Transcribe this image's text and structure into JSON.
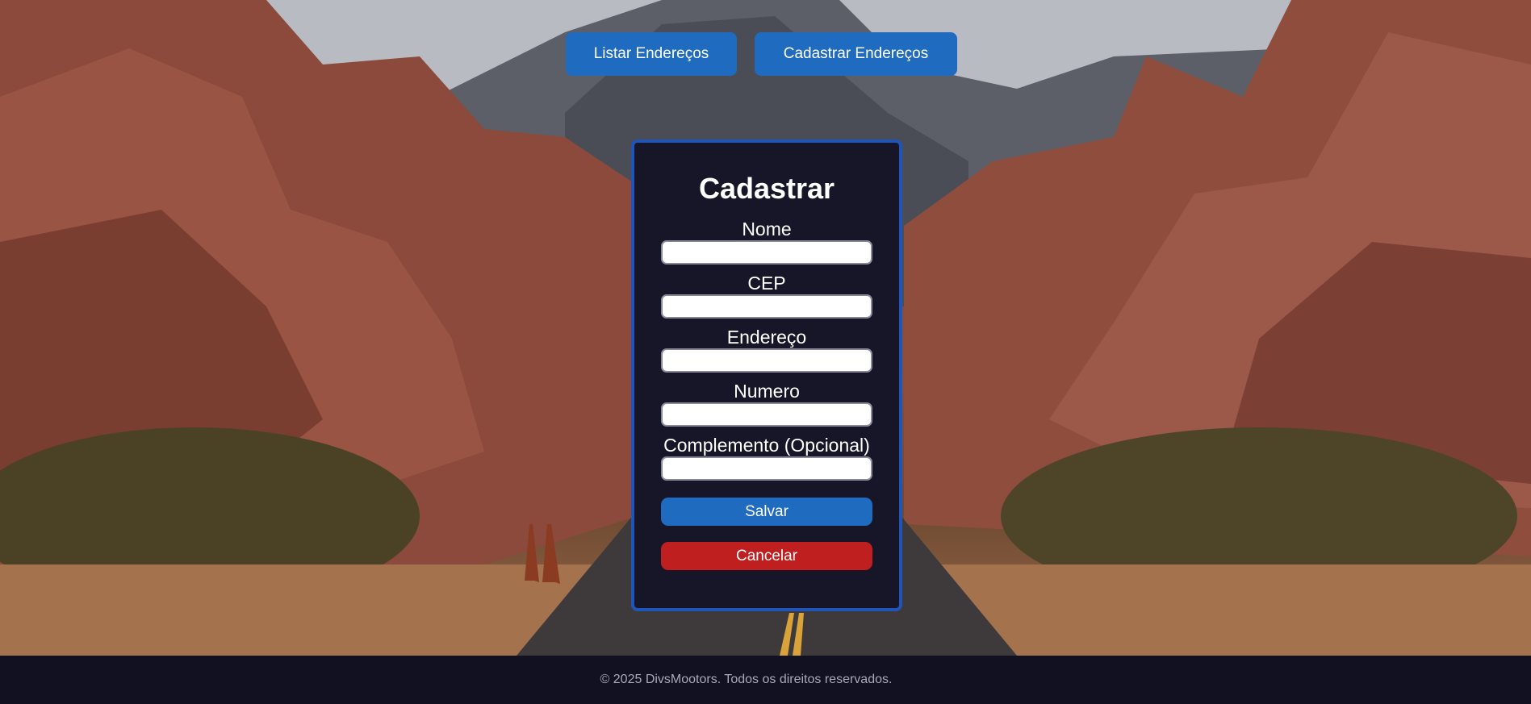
{
  "nav": {
    "list_label": "Listar Endereços",
    "register_label": "Cadastrar Endereços"
  },
  "form": {
    "title": "Cadastrar",
    "fields": [
      {
        "label": "Nome",
        "value": ""
      },
      {
        "label": "CEP",
        "value": ""
      },
      {
        "label": "Endereço",
        "value": ""
      },
      {
        "label": "Numero",
        "value": ""
      },
      {
        "label": "Complemento (Opcional)",
        "value": ""
      }
    ],
    "save_label": "Salvar",
    "cancel_label": "Cancelar"
  },
  "footer": {
    "text": "© 2025 DivsMootors. Todos os direitos reservados."
  },
  "colors": {
    "primary": "#1f6bbf",
    "danger": "#bf1f1f",
    "card_bg": "#161628",
    "card_border": "#1f54b8",
    "footer_bg": "#111122"
  }
}
